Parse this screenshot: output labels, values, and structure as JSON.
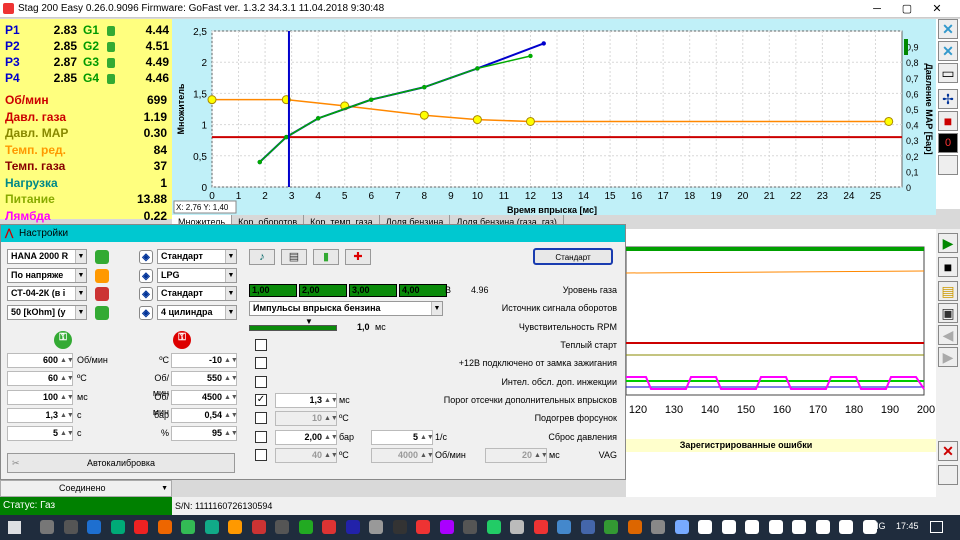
{
  "window": {
    "title": "Stag 200 Easy 0.26.0.9096 Firmware: GoFast  ver. 1.3.2  34.3.1   11.04.2018 9:30:48"
  },
  "injectors": [
    {
      "p": "P1",
      "pv": "2.83",
      "g": "G1",
      "gv": "4.44"
    },
    {
      "p": "P2",
      "pv": "2.85",
      "g": "G2",
      "gv": "4.51"
    },
    {
      "p": "P3",
      "pv": "2.87",
      "g": "G3",
      "gv": "4.49"
    },
    {
      "p": "P4",
      "pv": "2.85",
      "g": "G4",
      "gv": "4.46"
    }
  ],
  "params": [
    {
      "label": "Об/мин",
      "value": "699",
      "color": "#cc0000"
    },
    {
      "label": "Давл. газа",
      "value": "1.19",
      "color": "#cc0000"
    },
    {
      "label": "Давл. MAP",
      "value": "0.30",
      "color": "#888800"
    },
    {
      "label": "Темп. ред.",
      "value": "84",
      "color": "#ff9900"
    },
    {
      "label": "Темп. газа",
      "value": "37",
      "color": "#880000"
    },
    {
      "label": "Нагрузка",
      "value": "1",
      "color": "#008888"
    },
    {
      "label": "Питание",
      "value": "13.88",
      "color": "#88aa00"
    },
    {
      "label": "Лямбда",
      "value": "0.22",
      "color": "#ff00ff"
    }
  ],
  "chart_data": {
    "type": "scatter",
    "xlabel": "Время впрыска [мс]",
    "ylabel": "Множитель",
    "y2label": "Давление MAP [Бар]",
    "xlim": [
      0,
      26
    ],
    "ylim": [
      0,
      2.5
    ],
    "y2lim": [
      0,
      1
    ],
    "x_ticks": [
      "0",
      "1",
      "2",
      "3",
      "4",
      "5",
      "6",
      "7",
      "8",
      "9",
      "10",
      "11",
      "12",
      "13",
      "14",
      "15",
      "16",
      "17",
      "18",
      "19",
      "20",
      "21",
      "22",
      "23",
      "24",
      "25"
    ],
    "y_ticks": [
      "0",
      "0,5",
      "1",
      "1,5",
      "2",
      "2,5"
    ],
    "y2_ticks": [
      "0",
      "0,1",
      "0,2",
      "0,3",
      "0,4",
      "0,5",
      "0,6",
      "0,7",
      "0,8",
      "0,9"
    ],
    "cursor_label": "X: 2,76  Y: 1,40",
    "cursor_x": 2.9,
    "red_line_y": 0.8,
    "series": [
      {
        "values": [
          [
            0,
            1.4
          ],
          [
            2.8,
            1.4
          ],
          [
            5,
            1.3
          ],
          [
            8,
            1.15
          ],
          [
            10,
            1.08
          ],
          [
            12,
            1.05
          ],
          [
            25.5,
            1.05
          ]
        ],
        "color": "#ff8800"
      },
      {
        "values": [
          [
            1.8,
            0.4
          ],
          [
            2.8,
            0.8
          ],
          [
            4,
            1.1
          ],
          [
            6,
            1.4
          ],
          [
            8,
            1.6
          ],
          [
            10,
            1.9
          ],
          [
            12.5,
            2.3
          ]
        ],
        "color": "#0000cc"
      },
      {
        "values": [
          [
            1.8,
            0.4
          ],
          [
            2.8,
            0.8
          ],
          [
            4,
            1.1
          ],
          [
            6,
            1.4
          ],
          [
            8,
            1.6
          ],
          [
            10,
            1.9
          ],
          [
            12,
            2.1
          ]
        ],
        "color": "#00aa00"
      }
    ]
  },
  "tabs": [
    "Множитель",
    "Кор. оборотов",
    "Кор. темп. газа",
    "Доля бензина",
    "Доля бензина (газа, газ)"
  ],
  "dialog": {
    "title": "Настройки",
    "left_selects": [
      "HANA 2000 R",
      "По напряже",
      "СТ-04-2К (в і",
      "50 [kOhm] (у"
    ],
    "mid_selects": [
      "Стандарт",
      "LPG",
      "Стандарт",
      "4 цилиндра"
    ],
    "rows_left": [
      {
        "v": "600",
        "u": "Об/мин"
      },
      {
        "v": "60",
        "u": "ºC"
      },
      {
        "v": "100",
        "u": "мс"
      },
      {
        "v": "1,3",
        "u": "с"
      },
      {
        "v": "5",
        "u": "с"
      }
    ],
    "rows_mid": [
      {
        "u": "ºC",
        "v": "-10"
      },
      {
        "u": "Об/мин",
        "v": "550"
      },
      {
        "u": "Об/мин",
        "v": "4500"
      },
      {
        "u": "бар",
        "v": "0,54"
      },
      {
        "u": "%",
        "v": "95"
      }
    ],
    "autocal": "Автокалибровка",
    "standard_btn": "Стандарт",
    "gas_levels": [
      "1,00",
      "2,00",
      "3,00",
      "4,00"
    ],
    "gas_unit": "B",
    "gas_value": "4.96",
    "gas_label": "Уровень газа",
    "rpm_source_sel": "Импульсы впрыска бензина",
    "rpm_source_label": "Источник сигнала оборотов",
    "rpm_sens_value": "1,0",
    "rpm_sens_unit": "мс",
    "rpm_sens_label": "Чувствительность RPM",
    "checks": [
      {
        "label": "Теплый старт",
        "checked": false
      },
      {
        "label": "+12B подключено от замка зажигания",
        "checked": false
      },
      {
        "label": "Интел. обсл. доп. инжекции",
        "checked": false
      },
      {
        "label": "Порог отсечки дополнительных впрысков",
        "checked": true,
        "v": "1,3",
        "u": "мс"
      },
      {
        "label": "Подогрев форсунок",
        "checked": false,
        "v": "10",
        "u": "ºC",
        "dis": true
      },
      {
        "label": "Сброс давления",
        "checked": false,
        "v": "2,00",
        "u": "бар",
        "v2": "5",
        "u2": "1/с"
      },
      {
        "label": "VAG",
        "checked": false,
        "v": "40",
        "u": "ºC",
        "v2": "4000",
        "u2": "Об/мин",
        "v3": "20",
        "u3": "мс",
        "dis": true
      }
    ]
  },
  "bottom": {
    "dropdown": "Соединено",
    "status": "Статус: Газ",
    "serial": "S/N: 1111160726130594",
    "errors_label": "Зарегистрированные ошибки"
  },
  "right_graph": {
    "ticks": [
      "120",
      "130",
      "140",
      "150",
      "160",
      "170",
      "180",
      "190",
      "200"
    ]
  },
  "taskbar": {
    "lang": "ENG",
    "time": "17:45"
  }
}
